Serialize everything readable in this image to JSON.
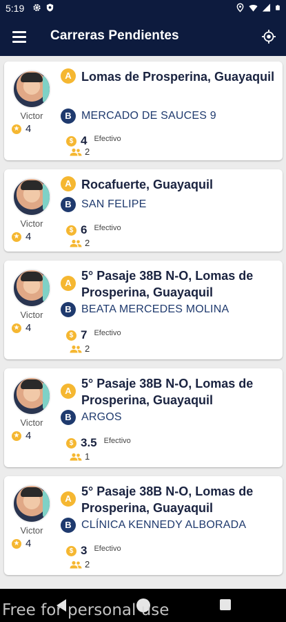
{
  "status": {
    "time": "5:19"
  },
  "app_bar": {
    "title": "Carreras Pendientes"
  },
  "rides": [
    {
      "driver": "Victor",
      "rating": "4",
      "origin": "Lomas de Prosperina, Guayaquil",
      "destination": "MERCADO DE SAUCES 9",
      "fare": "4",
      "payment": "Efectivo",
      "passengers": "2"
    },
    {
      "driver": "Victor",
      "rating": "4",
      "origin": "Rocafuerte, Guayaquil",
      "destination": "SAN FELIPE",
      "fare": "6",
      "payment": "Efectivo",
      "passengers": "2"
    },
    {
      "driver": "Victor",
      "rating": "4",
      "origin": "5° Pasaje 38B N-O, Lomas de Prosperina, Guayaquil",
      "destination": "BEATA MERCEDES MOLINA",
      "fare": "7",
      "payment": "Efectivo",
      "passengers": "2"
    },
    {
      "driver": "Victor",
      "rating": "4",
      "origin": "5° Pasaje 38B N-O, Lomas de Prosperina, Guayaquil",
      "destination": "ARGOS",
      "fare": "3.5",
      "payment": "Efectivo",
      "passengers": "1"
    },
    {
      "driver": "Victor",
      "rating": "4",
      "origin": "5° Pasaje 38B N-O, Lomas de Prosperina, Guayaquil",
      "destination": "CLÍNICA KENNEDY ALBORADA",
      "fare": "3",
      "payment": "Efectivo",
      "passengers": "2"
    }
  ],
  "markers": {
    "origin": "A",
    "destination": "B"
  },
  "icons": {
    "rating": "star-icon",
    "fare": "dollar-coin-icon",
    "passengers": "people-icon"
  },
  "watermark": "Free for personal use",
  "colors": {
    "primary": "#0d1b3e",
    "accent": "#f5b731",
    "marker_b": "#1f3a6e"
  }
}
